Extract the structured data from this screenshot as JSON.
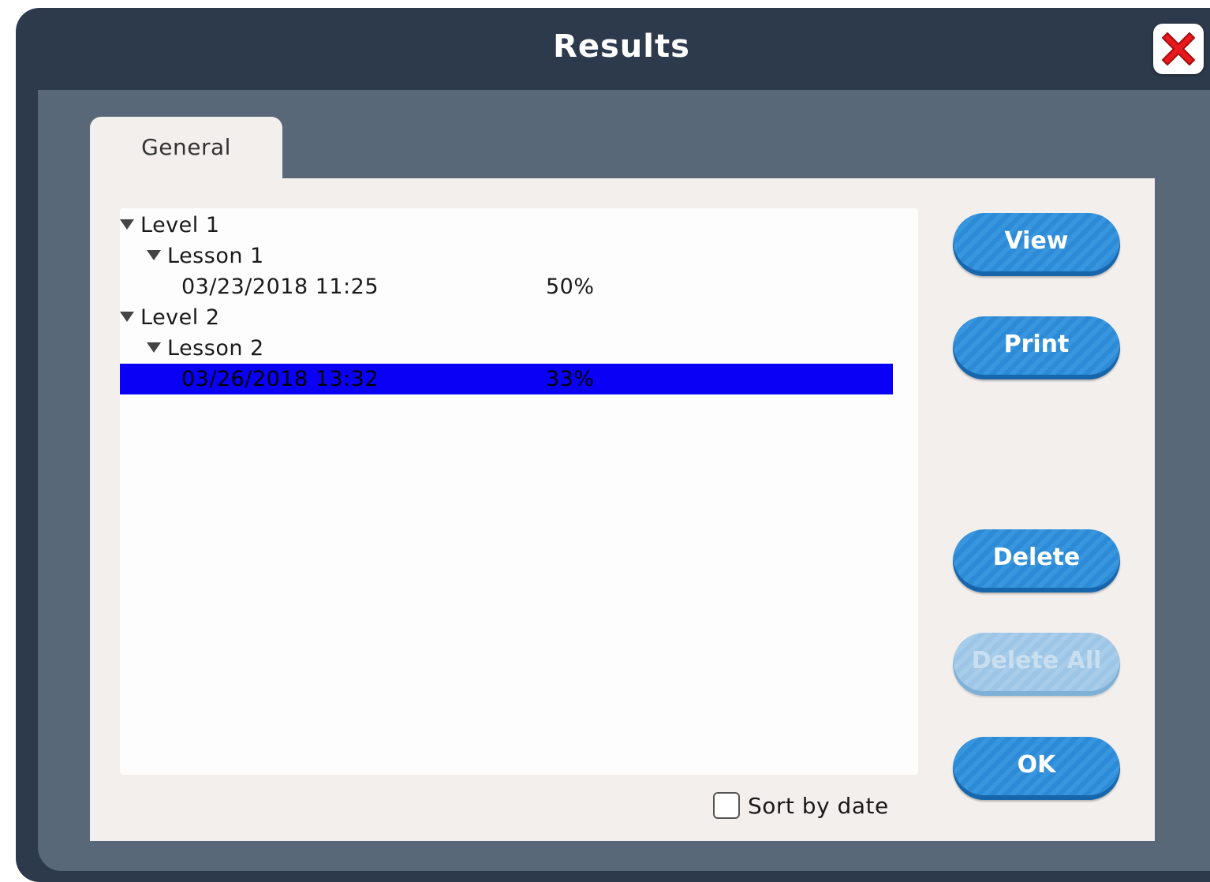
{
  "window": {
    "title": "Results"
  },
  "icons": {
    "close": "close-icon",
    "expand": "triangle-down-icon"
  },
  "tabs": [
    {
      "label": "General",
      "selected": true
    }
  ],
  "tree": {
    "levels": [
      {
        "label": "Level 1",
        "lessons": [
          {
            "label": "Lesson 1",
            "results": [
              {
                "date": "03/23/2018 11:25",
                "score": "50%"
              }
            ]
          }
        ]
      },
      {
        "label": "Level 2",
        "lessons": [
          {
            "label": "Lesson 2",
            "results": [
              {
                "date": "03/26/2018 13:32",
                "score": "33%",
                "selected": true
              }
            ]
          }
        ]
      }
    ]
  },
  "buttons": {
    "view": "View",
    "print": "Print",
    "delete": "Delete",
    "delete_all": "Delete All",
    "ok": "OK"
  },
  "sort": {
    "label": "Sort by date",
    "checked": false
  },
  "colors": {
    "titlebar": "#2c3a4c",
    "panel": "#586878",
    "selection": "#0a00f5",
    "button": "#2c8ad6",
    "close_red": "#e8191c"
  }
}
